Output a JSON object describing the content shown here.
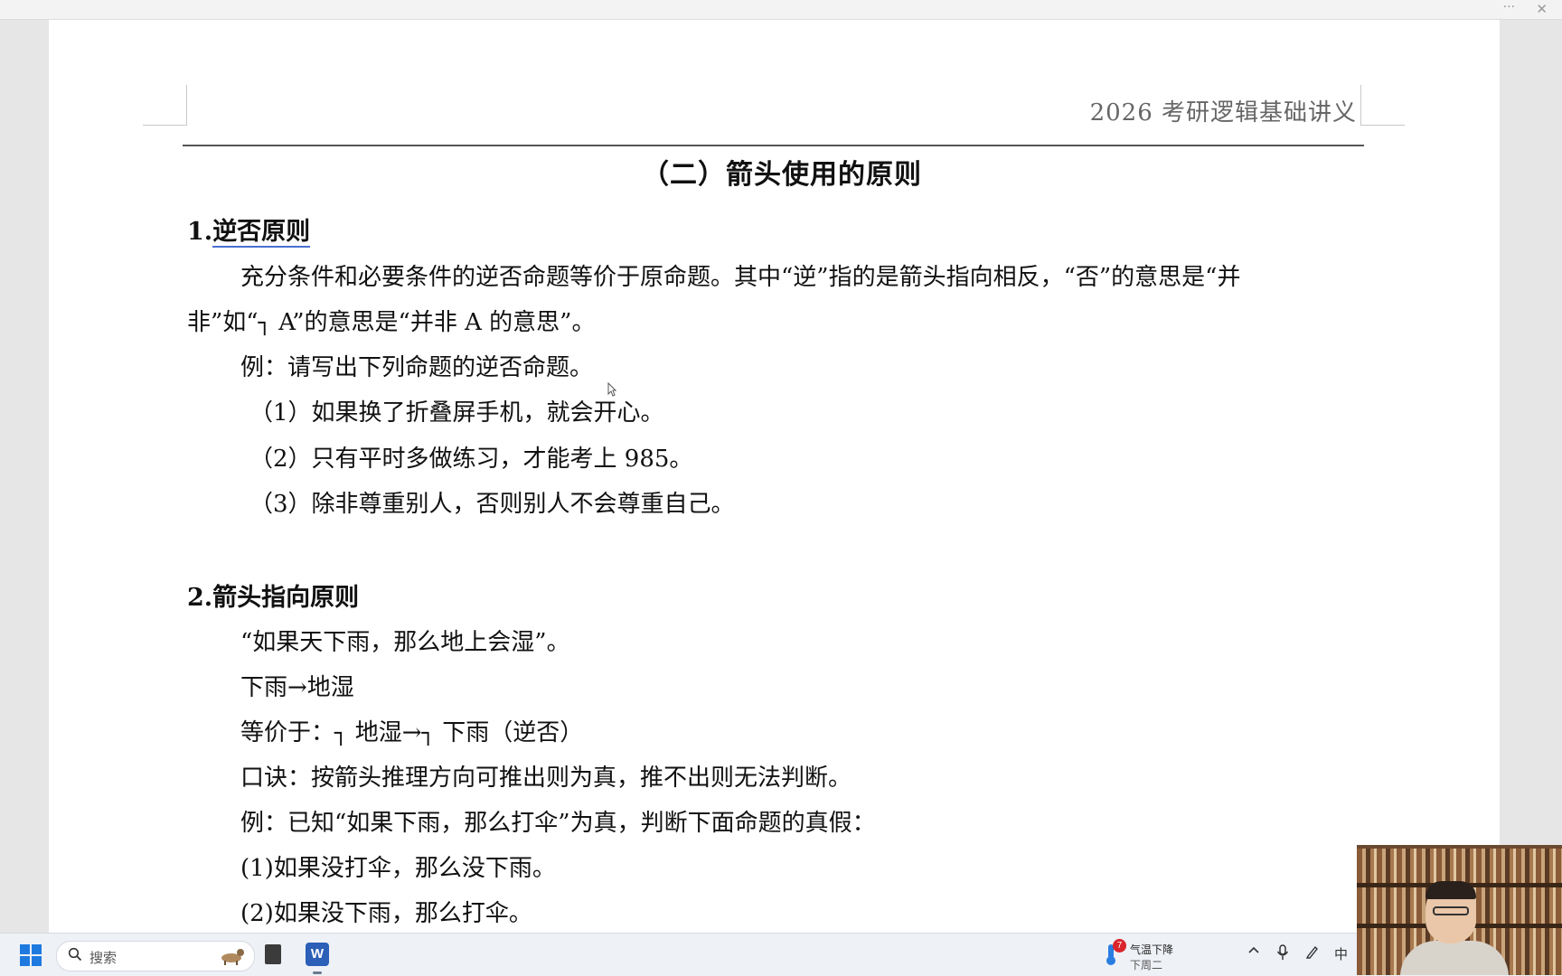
{
  "window": {
    "more_label": "···",
    "close_label": "✕"
  },
  "document": {
    "header_title": "2026 考研逻辑基础讲义",
    "section_title": "（二）箭头使用的原则",
    "heading1": {
      "num": "1.",
      "text": "逆否原则"
    },
    "para1_line1": "充分条件和必要条件的逆否命题等价于原命题。其中“逆”指的是箭头指向相反，“否”的意思是“并",
    "para1_line2": {
      "before": "非”如“",
      "neg": "┐",
      "after": " A”的意思是“并非 A 的意思”。"
    },
    "example1_intro": "例：请写出下列命题的逆否命题。",
    "example1_items": [
      "（1）如果换了折叠屏手机，就会开心。",
      "（2）只有平时多做练习，才能考上 985。",
      "（3）除非尊重别人，否则别人不会尊重自己。"
    ],
    "heading2": "2.箭头指向原则",
    "quote": "“如果天下雨，那么地上会湿”。",
    "arrow_line": "下雨→地湿",
    "equiv_line": {
      "prefix": "等价于：",
      "neg1": "┐",
      "mid": " 地湿→",
      "neg2": "┐",
      "suffix": " 下雨（逆否）"
    },
    "mnemonic": "口诀：按箭头推理方向可推出则为真，推不出则无法判断。",
    "example2_intro": "例：已知“如果下雨，那么打伞”为真，判断下面命题的真假：",
    "example2_items": [
      "(1)如果没打伞，那么没下雨。",
      "(2)如果没下雨，那么打伞。"
    ]
  },
  "taskbar": {
    "search_placeholder": "搜索",
    "word_icon_label": "W",
    "weather": {
      "badge": "7",
      "title": "气温下降",
      "subtitle": "下周二"
    },
    "ime_label": "中",
    "icons": [
      "windows-start-icon",
      "search-icon",
      "file-explorer-icon",
      "word-icon",
      "thermometer-icon",
      "chevron-up-icon",
      "microphone-icon",
      "pen-icon"
    ]
  },
  "colors": {
    "word_blue": "#2b5fb8",
    "windows_blue": "#1f7ae0",
    "badge_red": "#d9252b"
  }
}
